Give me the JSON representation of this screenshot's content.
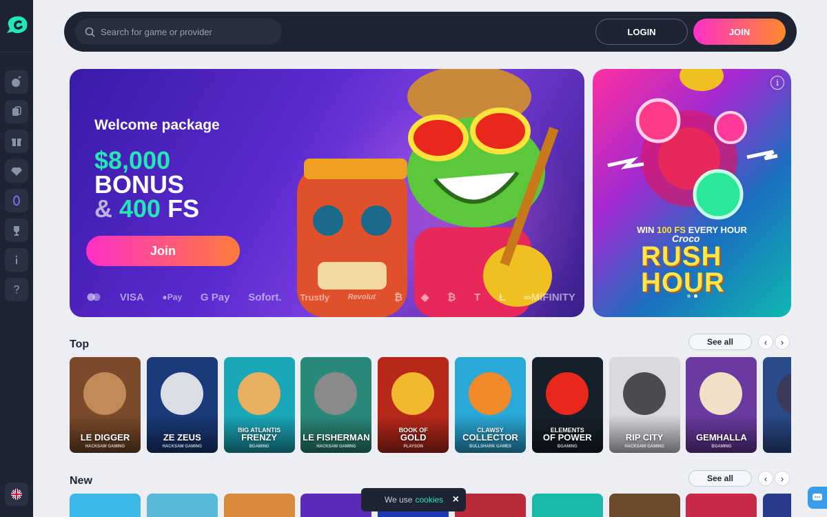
{
  "header": {
    "search_placeholder": "Search for game or provider",
    "login_label": "LOGIN",
    "join_label": "JOIN"
  },
  "sidebar": {
    "items": [
      {
        "icon": "slots-icon"
      },
      {
        "icon": "live-casino-icon"
      },
      {
        "icon": "gift-icon"
      },
      {
        "icon": "vip-diamond-icon"
      },
      {
        "icon": "zero-icon"
      },
      {
        "icon": "trophy-icon"
      },
      {
        "icon": "info-icon"
      },
      {
        "icon": "help-icon"
      }
    ],
    "language_icon": "uk-flag-icon"
  },
  "hero": {
    "title": "Welcome package",
    "amount": "$8,000",
    "bonus": "BONUS",
    "amp": "&",
    "fs_number": "400",
    "fs_label": "FS",
    "join_label": "Join",
    "payments": [
      "VISA",
      "Pay",
      "G Pay",
      "Sofort.",
      "Trustly",
      "Revolut",
      "T",
      "MiFINITY"
    ]
  },
  "promo": {
    "win_prefix": "WIN",
    "win_highlight": "100 FS",
    "win_suffix": "EVERY HOUR",
    "croco": "Croco",
    "rush": "RUSH",
    "hour": "HOUR"
  },
  "sections": {
    "top_title": "Top",
    "new_title": "New",
    "see_all": "See all"
  },
  "top_games": [
    {
      "sub": "",
      "name": "LE DIGGER",
      "provider": "HACKSAW GAMING",
      "bg": "#7a4a2a",
      "face": "#c08a5a"
    },
    {
      "sub": "",
      "name": "ZE ZEUS",
      "provider": "HACKSAW GAMING",
      "bg": "#1a3a7a",
      "face": "#d8dde6"
    },
    {
      "sub": "BIG ATLANTIS",
      "name": "FRENZY",
      "provider": "BGAMING",
      "bg": "#1aa8b8",
      "face": "#e8b060"
    },
    {
      "sub": "",
      "name": "LE FISHERMAN",
      "provider": "HACKSAW GAMING",
      "bg": "#2a8a7a",
      "face": "#8a8a8a"
    },
    {
      "sub": "BOOK OF",
      "name": "GOLD",
      "provider": "PLAYSON",
      "bg": "#b8281a",
      "face": "#f2b830"
    },
    {
      "sub": "CLAWSY",
      "name": "COLLECTOR",
      "provider": "BULLSHARK GAMES",
      "bg": "#2aa8d8",
      "face": "#f08a2a"
    },
    {
      "sub": "ELEMENTS",
      "name": "OF POWER",
      "provider": "BGAMING",
      "bg": "#16202a",
      "face": "#e8281a"
    },
    {
      "sub": "",
      "name": "RIP CITY",
      "provider": "HACKSAW GAMING",
      "bg": "#d8d8de",
      "face": "#4a4a50"
    },
    {
      "sub": "",
      "name": "GEMHALLA",
      "provider": "BGAMING",
      "bg": "#6a3aa0",
      "face": "#f0e0c8"
    },
    {
      "sub": "DET",
      "name": "DO",
      "provider": "F",
      "bg": "#2a4a8a",
      "face": "#3a3a5a"
    }
  ],
  "new_games": [
    {
      "bg": "#3ab8e8"
    },
    {
      "bg": "#5ab8d8"
    },
    {
      "bg": "#d88a3a"
    },
    {
      "bg": "#5a2ab8"
    },
    {
      "bg": "#1a3ab8"
    },
    {
      "bg": "#b82a3a"
    },
    {
      "bg": "#1ab8a8"
    },
    {
      "bg": "#6a4a2a"
    },
    {
      "bg": "#c82a4a"
    },
    {
      "bg": "#2a3a8a"
    }
  ],
  "cookie": {
    "text": "We use",
    "link": "cookies",
    "close": "×"
  }
}
